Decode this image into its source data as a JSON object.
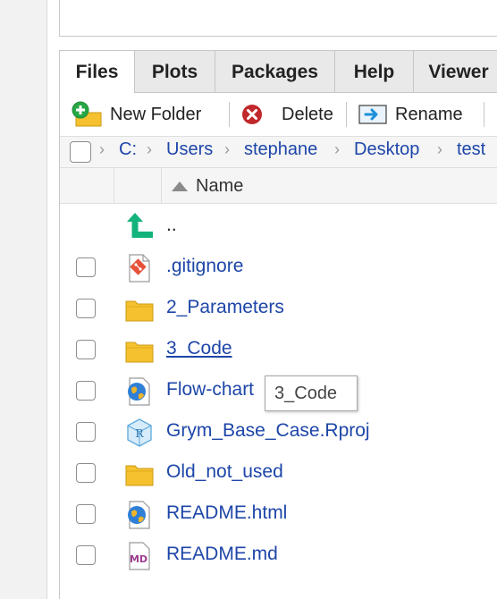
{
  "tabs": [
    {
      "label": "Files",
      "active": true
    },
    {
      "label": "Plots",
      "active": false
    },
    {
      "label": "Packages",
      "active": false
    },
    {
      "label": "Help",
      "active": false
    },
    {
      "label": "Viewer",
      "active": false
    }
  ],
  "toolbar": {
    "new_folder": "New Folder",
    "delete": "Delete",
    "rename": "Rename"
  },
  "breadcrumb": [
    "C:",
    "Users",
    "stephane",
    "Desktop",
    "test"
  ],
  "columns": {
    "name": "Name",
    "sort_direction": "ascending"
  },
  "files": [
    {
      "name": "..",
      "icon": "parent-directory-icon",
      "checkbox": false
    },
    {
      "name": ".gitignore",
      "icon": "git-file-icon",
      "checkbox": true
    },
    {
      "name": "2_Parameters",
      "icon": "folder-icon",
      "checkbox": true
    },
    {
      "name": "3_Code",
      "icon": "folder-icon",
      "checkbox": true,
      "hovered": true
    },
    {
      "name": "Flow-chart",
      "icon": "html-globe-icon",
      "checkbox": true
    },
    {
      "name": "Grym_Base_Case.Rproj",
      "icon": "rproj-cube-icon",
      "checkbox": true
    },
    {
      "name": "Old_not_used",
      "icon": "folder-icon",
      "checkbox": true
    },
    {
      "name": "README.html",
      "icon": "html-globe-icon",
      "checkbox": true
    },
    {
      "name": "README.md",
      "icon": "markdown-icon",
      "checkbox": true
    }
  ],
  "tooltip": "3_Code",
  "colors": {
    "link": "#1d46a8",
    "folder": "#f5c12e",
    "new_folder_green": "#27a745",
    "delete_red": "#c0282b",
    "rename_blue": "#1c8fd9",
    "up_arrow_green": "#15b37c",
    "git_orange": "#e7513b",
    "markdown_purple": "#9b3c8f"
  }
}
